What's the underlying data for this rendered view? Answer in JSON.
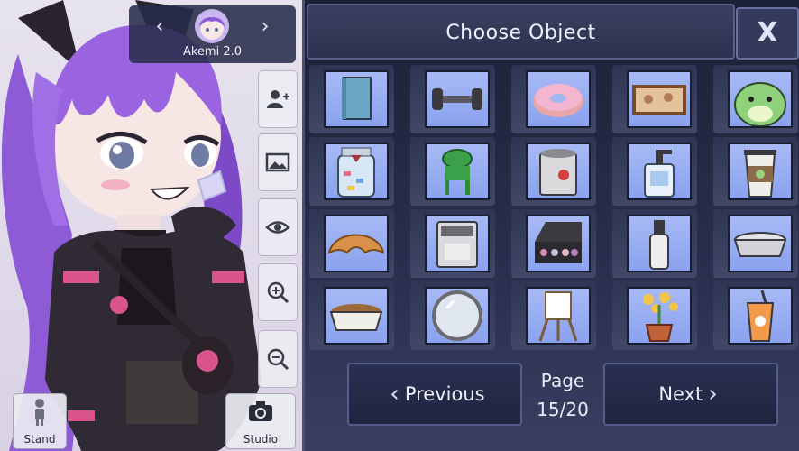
{
  "character": {
    "name": "Akemi 2.0",
    "prev_icon": "chevron-left-icon",
    "next_icon": "chevron-right-icon"
  },
  "side_tools": [
    {
      "name": "add-character",
      "icon": "add-person-icon"
    },
    {
      "name": "background",
      "icon": "image-icon"
    },
    {
      "name": "visibility",
      "icon": "eye-icon"
    },
    {
      "name": "zoom-in",
      "icon": "zoom-in-icon"
    },
    {
      "name": "zoom-out",
      "icon": "zoom-out-icon"
    }
  ],
  "bottom_buttons": {
    "stand_label": "Stand",
    "studio_label": "Studio"
  },
  "panel": {
    "title": "Choose Object",
    "close_label": "X"
  },
  "objects": [
    "book",
    "dumbbell",
    "donut",
    "painting",
    "frog-plush",
    "candy-jar",
    "frog-chair",
    "paint-bucket",
    "soap-dispenser",
    "coffee-cup",
    "croissant",
    "coffee-machine",
    "makeup-palette",
    "spray-bottle",
    "bowl",
    "food-bowl",
    "mirror",
    "easel",
    "flower-pot",
    "boba-drink"
  ],
  "pagination": {
    "previous_label": "Previous",
    "next_label": "Next",
    "page_label": "Page",
    "page_count": "15/20",
    "current_page": 15,
    "total_pages": 20
  },
  "colors": {
    "panel_bg": "#1c2036",
    "tile_bg": "#a7b9f4",
    "hair": "#8e5bd6",
    "jacket": "#2f2a33",
    "accent_pink": "#d9538c"
  }
}
